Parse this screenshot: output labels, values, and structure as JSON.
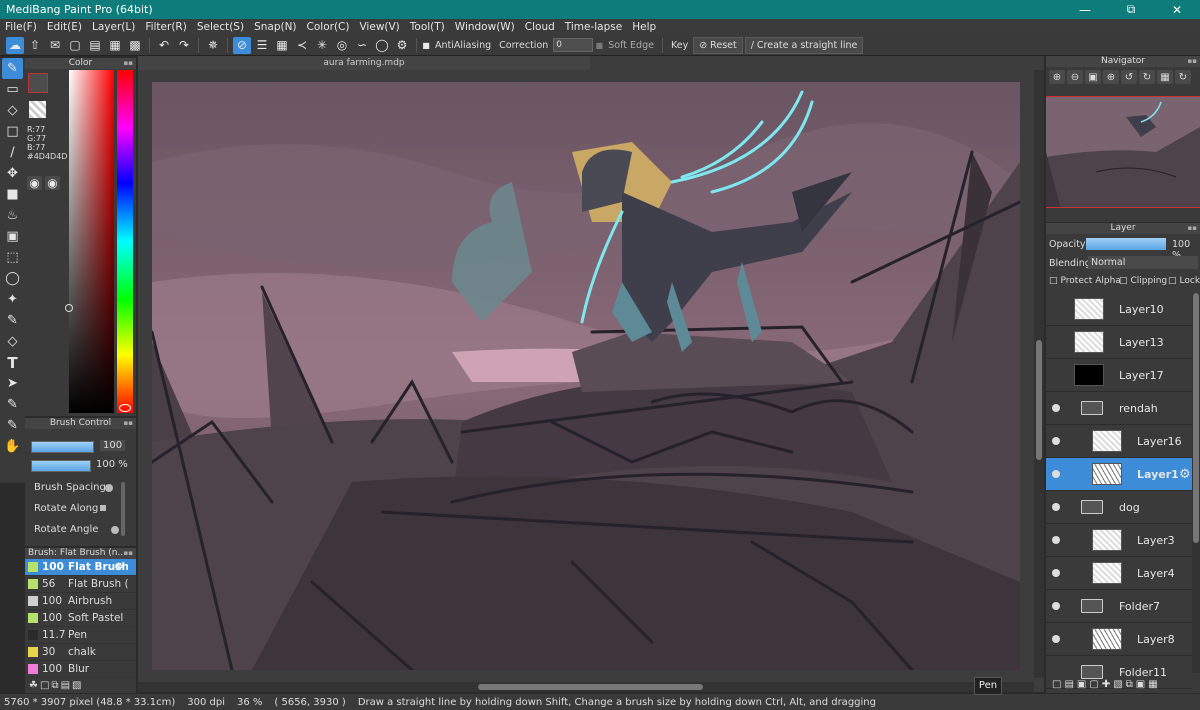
{
  "window": {
    "title": "MediBang Paint Pro (64bit)"
  },
  "menu": [
    "File(F)",
    "Edit(E)",
    "Layer(L)",
    "Filter(R)",
    "Select(S)",
    "Snap(N)",
    "Color(C)",
    "View(V)",
    "Tool(T)",
    "Window(W)",
    "Cloud",
    "Time-lapse",
    "Help"
  ],
  "toolbar": {
    "antialiasing_label": "AntiAliasing",
    "correction_label": "Correction",
    "correction_value": "0",
    "soft_edge_label": "Soft Edge",
    "key_label": "Key",
    "reset_label": "Reset",
    "straight_line_label": "Create a straight line"
  },
  "color_panel": {
    "title": "Color",
    "r": "R:77",
    "g": "G:77",
    "b": "B:77",
    "hex": "#4D4D4D",
    "current_color": "#4d4d4d"
  },
  "brush_control": {
    "title": "Brush Control",
    "size_value": "100",
    "size_fraction": 0.9,
    "opacity_value": "100 %",
    "opacity_fraction": 1.0,
    "spacing_label": "Brush Spacing",
    "rotate_along_label": "Rotate Along",
    "rotate_angle_label": "Rotate Angle"
  },
  "brush_list": {
    "title": "Brush: Flat Brush (n...",
    "items": [
      {
        "size": "100",
        "name": "Flat Brush",
        "color": "#b6e26b",
        "selected": true
      },
      {
        "size": "56",
        "name": "Flat Brush (",
        "color": "#b6e26b",
        "selected": false
      },
      {
        "size": "100",
        "name": "Airbrush",
        "color": "#cfcfcf",
        "selected": false
      },
      {
        "size": "100",
        "name": "Soft Pastel",
        "color": "#b6e26b",
        "selected": false
      },
      {
        "size": "11.7",
        "name": "Pen",
        "color": "#2a2a2a",
        "selected": false
      },
      {
        "size": "30",
        "name": "chalk",
        "color": "#e8d44a",
        "selected": false
      },
      {
        "size": "100",
        "name": "Blur",
        "color": "#f07ed8",
        "selected": false
      }
    ]
  },
  "document": {
    "tab": "aura farming.mdp"
  },
  "navigator": {
    "title": "Navigator"
  },
  "layer_panel": {
    "title": "Layer",
    "opacity_label": "Opacity",
    "opacity_value": "100 %",
    "blending_label": "Blending",
    "blending_value": "Normal",
    "protect_alpha_label": "Protect Alpha",
    "clipping_label": "Clipping",
    "lock_label": "Lock",
    "layers": [
      {
        "name": "Layer10",
        "type": "layer",
        "indent": 0,
        "eye": false,
        "thumb": "checker"
      },
      {
        "name": "Layer13",
        "type": "layer",
        "indent": 0,
        "eye": false,
        "thumb": "checker"
      },
      {
        "name": "Layer17",
        "type": "layer",
        "indent": 0,
        "eye": false,
        "thumb": "black"
      },
      {
        "name": "rendah",
        "type": "folder",
        "indent": 0,
        "eye": true
      },
      {
        "name": "Layer16",
        "type": "layer",
        "indent": 1,
        "eye": true,
        "thumb": "checker"
      },
      {
        "name": "Layer1",
        "type": "layer",
        "indent": 1,
        "eye": true,
        "thumb": "sketch",
        "selected": true
      },
      {
        "name": "dog",
        "type": "folder",
        "indent": 0,
        "eye": true
      },
      {
        "name": "Layer3",
        "type": "layer",
        "indent": 1,
        "eye": true,
        "thumb": "checker"
      },
      {
        "name": "Layer4",
        "type": "layer",
        "indent": 1,
        "eye": true,
        "thumb": "checker"
      },
      {
        "name": "Folder7",
        "type": "folder",
        "indent": 0,
        "eye": true
      },
      {
        "name": "Layer8",
        "type": "layer",
        "indent": 1,
        "eye": true,
        "thumb": "sketch"
      },
      {
        "name": "Folder11",
        "type": "folder",
        "indent": 0,
        "eye": false
      }
    ]
  },
  "status": {
    "size": "5760 * 3907 pixel",
    "size_cm": "(48.8 * 33.1cm)",
    "dpi": "300 dpi",
    "zoom": "36 %",
    "coords": "( 5656, 3930 )",
    "hint": "Draw a straight line by holding down Shift, Change a brush size by holding down Ctrl, Alt, and dragging"
  },
  "tooltip": "Pen"
}
